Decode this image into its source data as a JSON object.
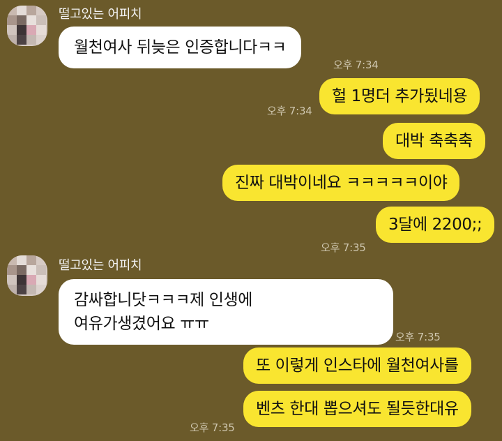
{
  "messages": [
    {
      "sender": "떨고있는 어피치",
      "text": "월천여사 뒤늦은  인증합니다ㅋㅋ",
      "time": "오후 7:34"
    },
    {
      "text": "헐 1명더 추가됬네용",
      "time": "오후 7:34"
    },
    {
      "text": "대박 축축축"
    },
    {
      "text": "진짜 대박이네요 ㅋㅋㅋㅋㅋ이야"
    },
    {
      "text": "3달에 2200;;",
      "time": "오후 7:35"
    },
    {
      "sender": "떨고있는 어피치",
      "lines": [
        "감싸합니닷ㅋㅋㅋ제 인생에",
        "여유가생겼어요 ㅠㅠ"
      ],
      "time": "오후 7:35"
    },
    {
      "text": "또 이렇게 인스타에 월천여사를"
    },
    {
      "text": "벤츠 한대 뽑으셔도 될듯한대유",
      "time": "오후 7:35"
    }
  ],
  "colors": {
    "background": "#6b5a2a",
    "incoming_bubble": "#ffffff",
    "outgoing_bubble": "#f9e530",
    "timestamp": "#cfc7b0"
  }
}
